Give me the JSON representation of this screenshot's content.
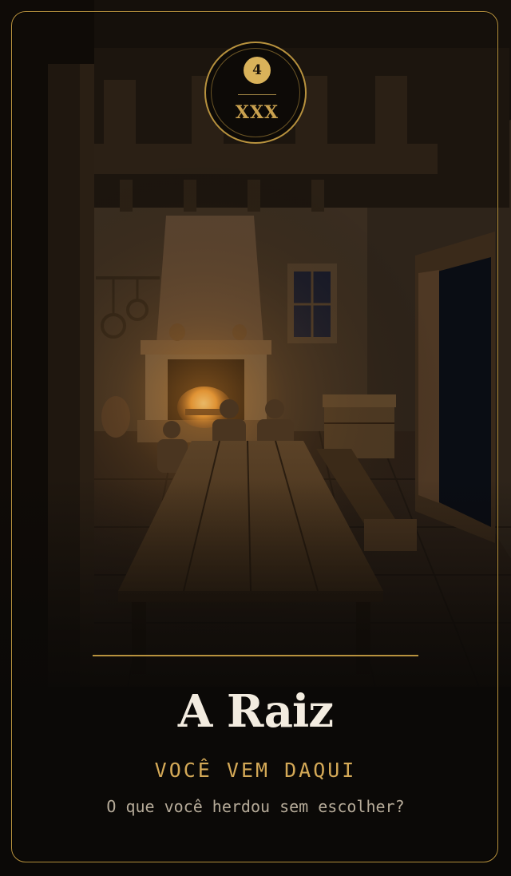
{
  "card": {
    "number": "4",
    "numeral": "XXX",
    "title": "A Raiz",
    "subtitle": "VOCÊ VEM DAQUI",
    "question": "O que você herdou sem escolher?"
  },
  "colors": {
    "gold": "#b8923e",
    "gold_light": "#d9b25a",
    "background": "#0b0907",
    "title": "#f3ece0",
    "question": "#b5aa98"
  },
  "icons": [
    "fireplace-icon",
    "table-icon",
    "window-icon",
    "door-icon",
    "chest-icon"
  ]
}
